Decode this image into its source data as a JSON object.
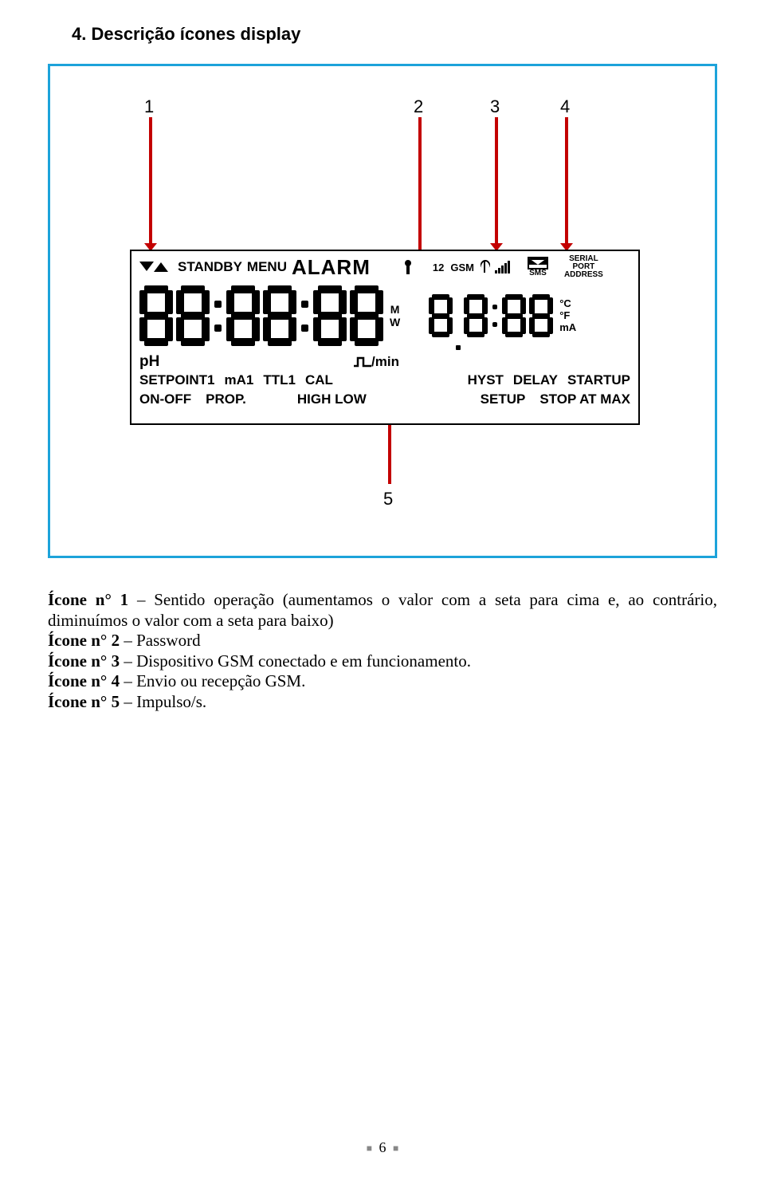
{
  "heading": "4. Descrição ícones display",
  "callouts": {
    "c1": "1",
    "c2": "2",
    "c3": "3",
    "c4": "4",
    "c5": "5"
  },
  "lcd": {
    "top": {
      "standby": "STANDBY",
      "menu": "MENU",
      "alarm": "ALARM",
      "twelve": "12",
      "gsm": "GSM",
      "sms": "SMS",
      "serial": "SERIAL",
      "port": "PORT",
      "address": "ADDRESS"
    },
    "mid": {
      "m": "M",
      "w": "W",
      "degC": "°C",
      "degF": "°F",
      "mA": "mA"
    },
    "row_ph": "pH",
    "row_pulse_min": "/min",
    "row3": {
      "setpoint1": "SETPOINT1",
      "ma1": "mA1",
      "ttl1": "TTL1",
      "cal": "CAL",
      "hyst": "HYST",
      "delay": "DELAY",
      "startup": "STARTUP"
    },
    "row4": {
      "onoff": "ON-OFF",
      "prop": "PROP.",
      "highlow": "HIGH LOW",
      "setup": "SETUP",
      "stopatmax": "STOP AT MAX"
    }
  },
  "descriptions": {
    "d1_prefix": "Ícone n° 1",
    "d1_text": " – Sentido operação (aumentamos o valor com a seta para cima e, ao contrário, diminuímos o valor com a seta para baixo)",
    "d2_prefix": "Ícone n° 2",
    "d2_text": " – Password",
    "d3_prefix": "Ícone n° 3",
    "d3_text": " – Dispositivo GSM conectado e em funcionamento.",
    "d4_prefix": "Ícone n° 4",
    "d4_text": " – Envio ou recepção GSM.",
    "d5_prefix": "Ícone n° 5",
    "d5_text": " – Impulso/s."
  },
  "page_number": "6"
}
